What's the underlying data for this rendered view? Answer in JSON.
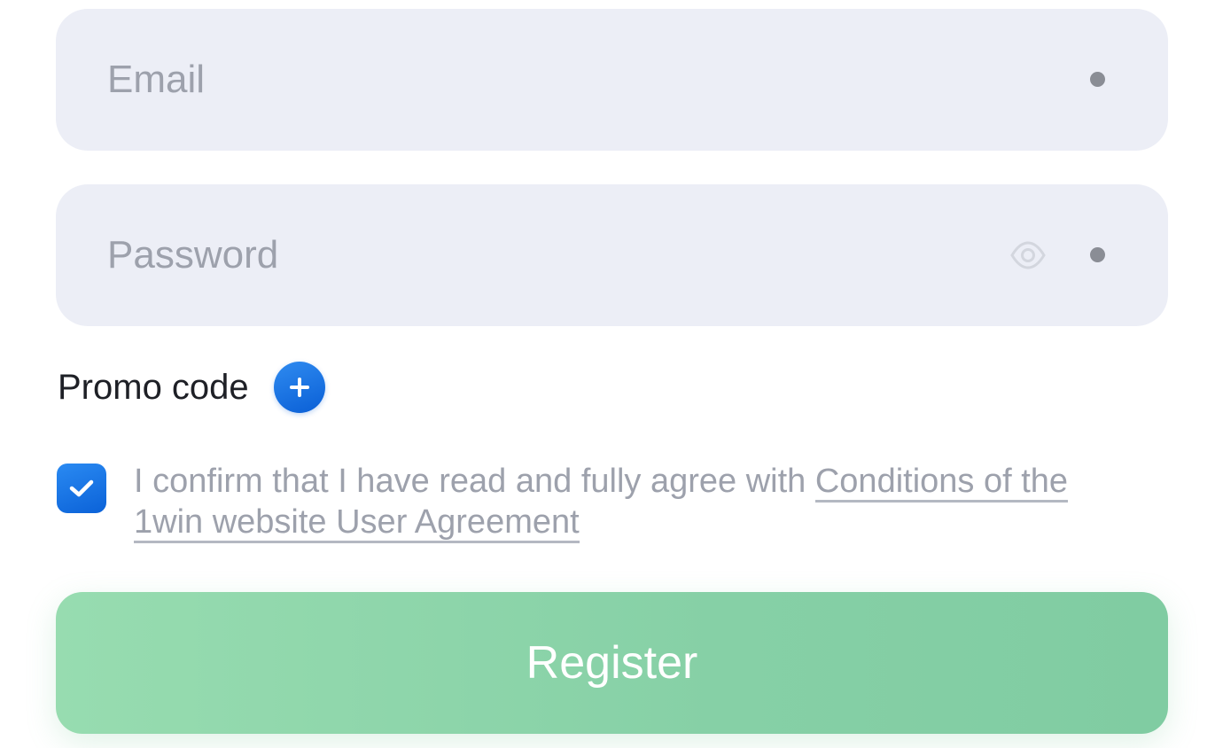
{
  "email_field": {
    "placeholder": "Email",
    "value": "",
    "required_indicator": "dot"
  },
  "password_field": {
    "placeholder": "Password",
    "value": "",
    "toggle_icon": "eye-icon",
    "required_indicator": "dot"
  },
  "promo": {
    "label": "Promo code",
    "add_icon": "plus-icon"
  },
  "agreement": {
    "checked": true,
    "text": "I confirm that I have read and fully agree with ",
    "link_text": "Conditions of the 1win website User Agreement"
  },
  "register_button": {
    "label": "Register"
  },
  "colors": {
    "field_bg": "#eceef6",
    "accent_blue": "#0b62d8",
    "register_green": "#8ad3a9",
    "placeholder_gray": "#9da1ac"
  }
}
